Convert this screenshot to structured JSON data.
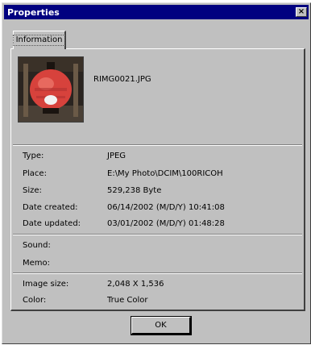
{
  "window": {
    "title": "Properties",
    "close_glyph": "×"
  },
  "tabs": [
    {
      "label": "Information",
      "selected": true
    }
  ],
  "file": {
    "name": "RIMG0021.JPG"
  },
  "details": {
    "type": {
      "label": "Type:",
      "value": "JPEG"
    },
    "place": {
      "label": "Place:",
      "value": "E:\\My Photo\\DCIM\\100RICOH"
    },
    "size": {
      "label": "Size:",
      "value": "529,238 Byte"
    },
    "date_created": {
      "label": "Date created:",
      "value": "06/14/2002 (M/D/Y)  10:41:08"
    },
    "date_updated": {
      "label": "Date updated:",
      "value": "03/01/2002 (M/D/Y)  01:48:28"
    },
    "sound": {
      "label": "Sound:",
      "value": ""
    },
    "memo": {
      "label": "Memo:",
      "value": ""
    },
    "image_size": {
      "label": "Image size:",
      "value": "2,048 X 1,536"
    },
    "color": {
      "label": "Color:",
      "value": "True Color"
    }
  },
  "buttons": {
    "ok_label": "OK"
  },
  "colors": {
    "titlebar": "#000080",
    "face": "#c0c0c0"
  }
}
